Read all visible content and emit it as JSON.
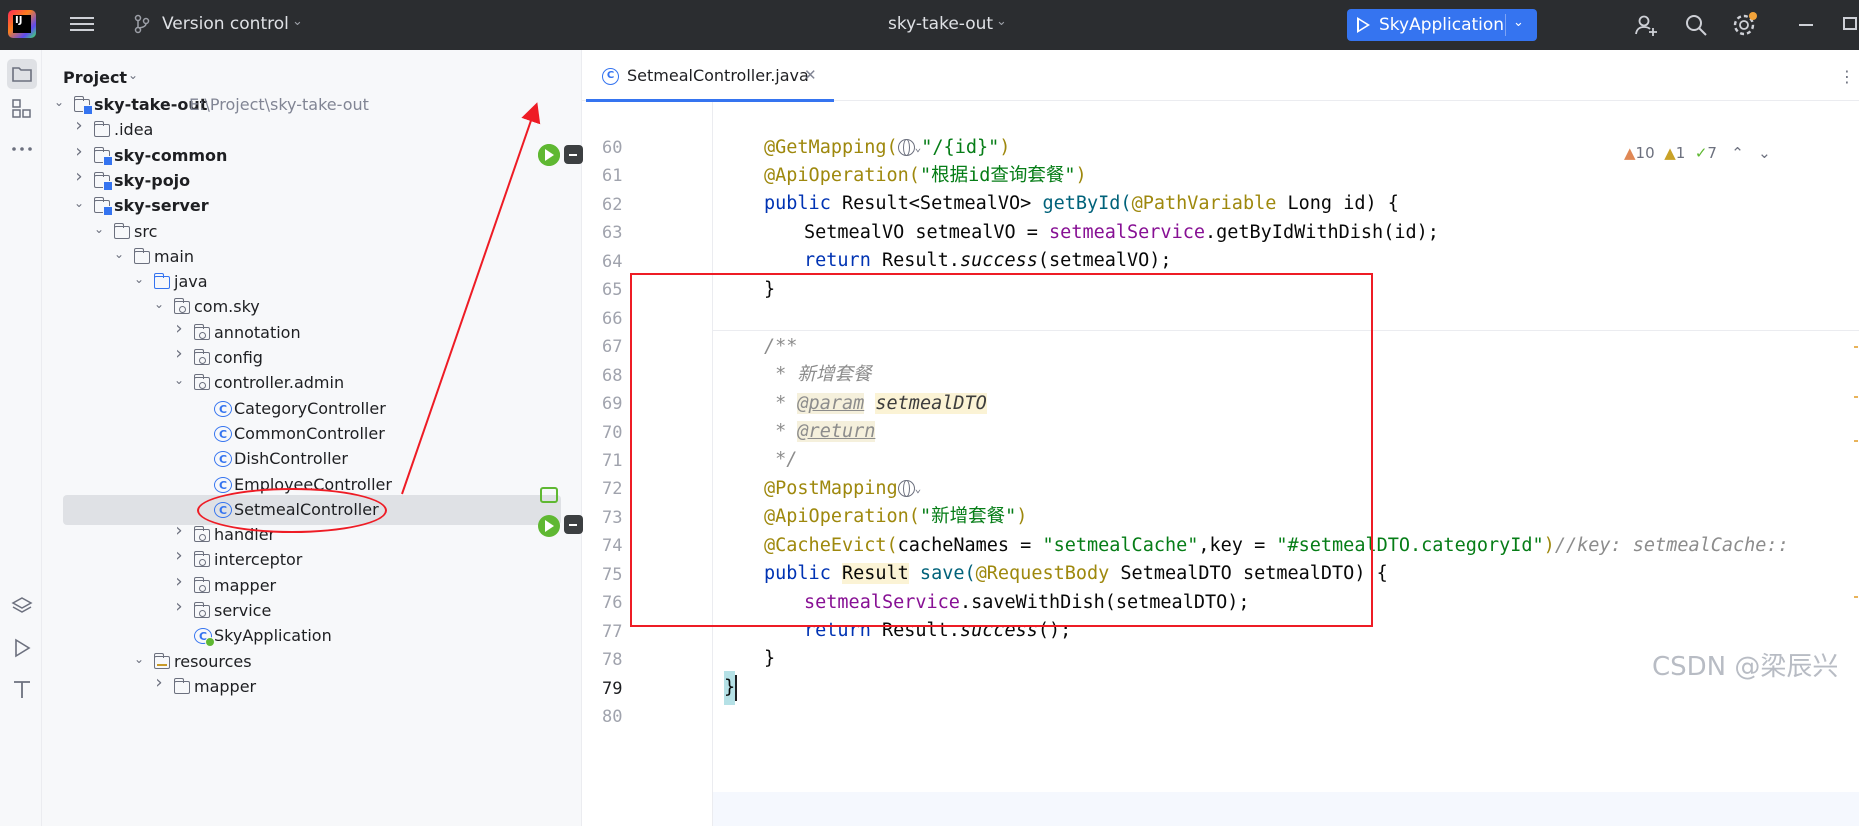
{
  "titlebar": {
    "version_control": "Version control",
    "project_name": "sky-take-out",
    "run_config": "SkyApplication"
  },
  "project_panel": {
    "title": "Project",
    "tree": [
      {
        "label": "sky-take-out",
        "path": "E:\\Project\\sky-take-out",
        "bold": true,
        "expanded": true,
        "icon": "module-folder-icon"
      },
      {
        "label": ".idea",
        "bold": false,
        "expanded": false,
        "icon": "folder-icon"
      },
      {
        "label": "sky-common",
        "bold": true,
        "expanded": false,
        "icon": "module-folder-icon"
      },
      {
        "label": "sky-pojo",
        "bold": true,
        "expanded": false,
        "icon": "module-folder-icon"
      },
      {
        "label": "sky-server",
        "bold": true,
        "expanded": true,
        "icon": "module-folder-icon"
      },
      {
        "label": "src",
        "bold": false,
        "expanded": true,
        "icon": "folder-icon"
      },
      {
        "label": "main",
        "bold": false,
        "expanded": true,
        "icon": "folder-icon"
      },
      {
        "label": "java",
        "bold": false,
        "expanded": true,
        "icon": "source-folder-icon"
      },
      {
        "label": "com.sky",
        "bold": false,
        "expanded": true,
        "icon": "package-icon"
      },
      {
        "label": "annotation",
        "bold": false,
        "expanded": false,
        "icon": "package-icon"
      },
      {
        "label": "config",
        "bold": false,
        "expanded": false,
        "icon": "package-icon"
      },
      {
        "label": "controller.admin",
        "bold": false,
        "expanded": true,
        "icon": "package-icon"
      },
      {
        "label": "CategoryController",
        "bold": false,
        "icon": "class-icon"
      },
      {
        "label": "CommonController",
        "bold": false,
        "icon": "class-icon"
      },
      {
        "label": "DishController",
        "bold": false,
        "icon": "class-icon"
      },
      {
        "label": "EmployeeController",
        "bold": false,
        "icon": "class-icon"
      },
      {
        "label": "SetmealController",
        "bold": false,
        "icon": "class-icon",
        "selected": true
      },
      {
        "label": "handler",
        "bold": false,
        "expanded": false,
        "icon": "package-icon"
      },
      {
        "label": "interceptor",
        "bold": false,
        "expanded": false,
        "icon": "package-icon"
      },
      {
        "label": "mapper",
        "bold": false,
        "expanded": false,
        "icon": "package-icon"
      },
      {
        "label": "service",
        "bold": false,
        "expanded": false,
        "icon": "package-icon"
      },
      {
        "label": "SkyApplication",
        "bold": false,
        "icon": "spring-app-icon"
      },
      {
        "label": "resources",
        "bold": false,
        "expanded": true,
        "icon": "resources-folder-icon"
      },
      {
        "label": "mapper",
        "bold": false,
        "expanded": false,
        "icon": "folder-icon"
      }
    ]
  },
  "editor": {
    "tab_label": "SetmealController.java",
    "inspections": {
      "warnings": "10",
      "weak_warnings": "1",
      "ok": "7"
    },
    "line_numbers": [
      "60",
      "61",
      "62",
      "63",
      "64",
      "65",
      "66",
      "67",
      "68",
      "69",
      "70",
      "71",
      "72",
      "73",
      "74",
      "75",
      "76",
      "77",
      "78",
      "79",
      "80"
    ],
    "code": {
      "l60_ann": "@GetMapping(",
      "l60_str": "\"/{id}\"",
      "l60_end": ")",
      "l61_ann": "@ApiOperation(",
      "l61_str": "\"根据id查询套餐\"",
      "l61_end": ")",
      "l62_kw": "public ",
      "l62_a": "Result<SetmealVO> ",
      "l62_m": "getById(",
      "l62_ann": "@PathVariable ",
      "l62_b": "Long id) {",
      "l63_a": "SetmealVO setmealVO = ",
      "l63_f": "setmealService",
      "l63_b": ".getByIdWithDish(id);",
      "l64_kw": "return ",
      "l64_a": "Result.",
      "l64_it": "success",
      "l64_b": "(setmealVO);",
      "l65": "}",
      "l67": "/**",
      "l68": " * 新增套餐",
      "l69_a": " * ",
      "l69_tag": "@param",
      "l69_b": " ",
      "l69_p": "setmealDTO",
      "l70_a": " * ",
      "l70_tag": "@return",
      "l71": " */",
      "l72_ann": "@PostMapping",
      "l73_ann": "@ApiOperation(",
      "l73_str": "\"新增套餐\"",
      "l73_end": ")",
      "l74_ann": "@CacheEvict(",
      "l74_a": "cacheNames = ",
      "l74_s1": "\"setmealCache\"",
      "l74_b": ",key = ",
      "l74_s2": "\"#setmealDTO.categoryId\"",
      "l74_c": ")",
      "l74_cm": "//key: setmealCache::",
      "l75_kw": "public ",
      "l75_r": "Result",
      "l75_m": " save(",
      "l75_ann": "@RequestBody ",
      "l75_b": "SetmealDTO setmealDTO) {",
      "l76_f": "setmealService",
      "l76_b": ".saveWithDish(setmealDTO);",
      "l77_kw": "return ",
      "l77_a": "Result.",
      "l77_it": "success",
      "l77_b": "();",
      "l78": "}",
      "l79": "}"
    }
  },
  "watermark": "CSDN @梁辰兴",
  "colors": {
    "titlebar_bg": "#2b2d30",
    "run_button": "#3574f0",
    "annotation_box": "#ee1c25",
    "annotation": "#9e880d",
    "string": "#067d17",
    "keyword": "#0033b3"
  }
}
